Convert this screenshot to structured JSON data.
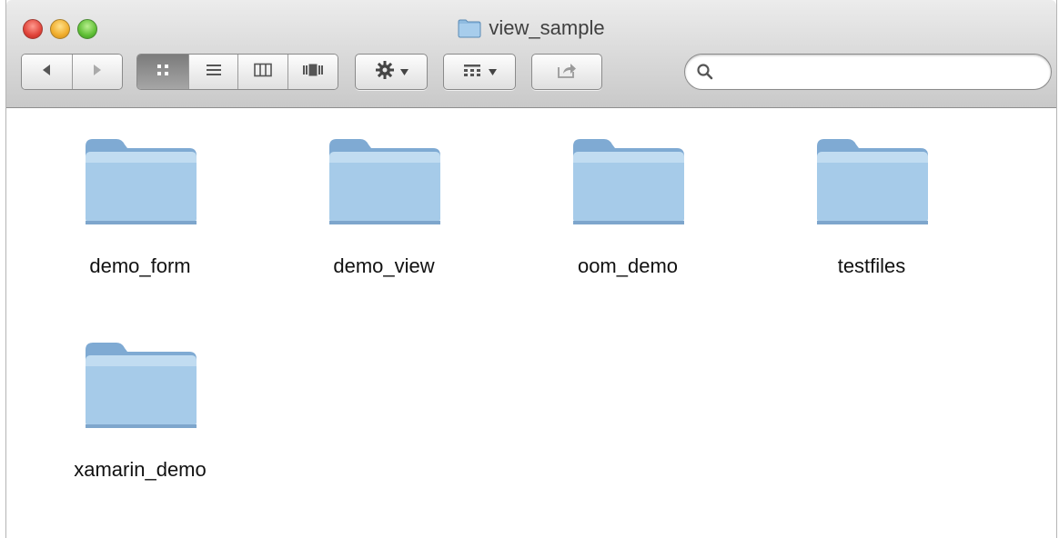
{
  "window": {
    "title": "view_sample"
  },
  "toolbar": {
    "back_icon": "back-arrow-icon",
    "forward_icon": "forward-arrow-icon",
    "view_modes": [
      "icon-view-icon",
      "list-view-icon",
      "column-view-icon",
      "coverflow-view-icon"
    ],
    "active_view": "icon",
    "action_icon": "gear-icon",
    "arrange_icon": "arrange-icon",
    "share_icon": "share-icon"
  },
  "search": {
    "value": "",
    "placeholder": ""
  },
  "items": [
    {
      "name": "demo_form"
    },
    {
      "name": "demo_view"
    },
    {
      "name": "oom_demo"
    },
    {
      "name": "testfiles"
    },
    {
      "name": "xamarin_demo"
    }
  ],
  "colors": {
    "folder_body": "#8fbbe0",
    "folder_tab": "#9ec4e6",
    "toolbar_bg": "#d6d6d6"
  }
}
